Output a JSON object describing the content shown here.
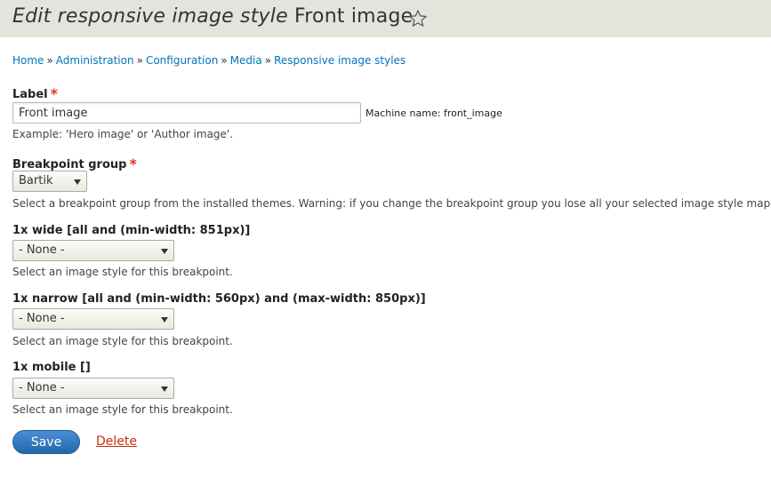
{
  "header": {
    "title_prefix": "Edit responsive image style",
    "title_name": "Front image",
    "star_icon": "star-outline-icon"
  },
  "breadcrumb": [
    "Home",
    "Administration",
    "Configuration",
    "Media",
    "Responsive image styles"
  ],
  "breadcrumb_separator": "»",
  "label_field": {
    "label": "Label",
    "required_mark": "*",
    "value": "Front image",
    "machine_name": "Machine name: front_image",
    "description": "Example: 'Hero image' or 'Author image'."
  },
  "breakpoint_group": {
    "label": "Breakpoint group",
    "required_mark": "*",
    "value": "Bartik",
    "description": "Select a breakpoint group from the installed themes. Warning: if you change the breakpoint group you lose all your selected image style mappings."
  },
  "breakpoints": [
    {
      "label": "1x wide [all and (min-width: 851px)]",
      "value": "- None -",
      "description": "Select an image style for this breakpoint."
    },
    {
      "label": "1x narrow [all and (min-width: 560px) and (max-width: 850px)]",
      "value": "- None -",
      "description": "Select an image style for this breakpoint."
    },
    {
      "label": "1x mobile []",
      "value": "- None -",
      "description": "Select an image style for this breakpoint."
    }
  ],
  "actions": {
    "save_label": "Save",
    "delete_label": "Delete"
  },
  "colors": {
    "header_bg": "#e4e3dc",
    "link": "#0074bd",
    "required": "#e2341d",
    "primary_button": "#2f7bc6",
    "danger_link": "#c4310c"
  }
}
